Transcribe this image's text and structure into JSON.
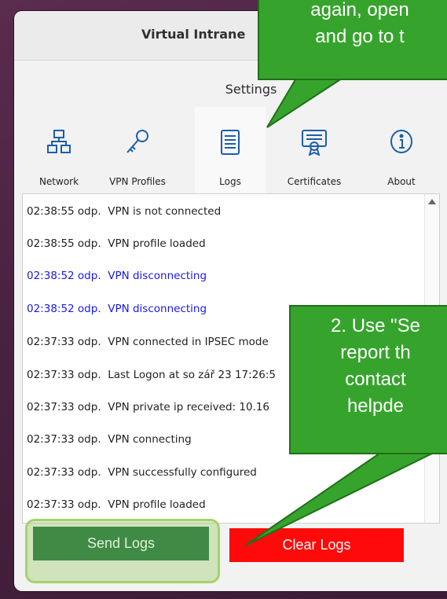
{
  "window": {
    "title": "Virtual Intrane"
  },
  "settings": {
    "label": "Settings"
  },
  "tabs": [
    {
      "label": "Network",
      "icon": "network-icon"
    },
    {
      "label": "VPN Profiles",
      "icon": "key-icon"
    },
    {
      "label": "Logs",
      "icon": "document-icon",
      "active": true
    },
    {
      "label": "Certificates",
      "icon": "certificate-icon"
    },
    {
      "label": "About",
      "icon": "info-icon"
    }
  ],
  "logs": [
    {
      "time": "02:38:55 odp.",
      "message": "VPN is not connected",
      "color": "#222222"
    },
    {
      "time": "02:38:55 odp.",
      "message": "VPN profile loaded",
      "color": "#222222"
    },
    {
      "time": "02:38:52 odp.",
      "message": "VPN disconnecting",
      "color": "#1a1ae6"
    },
    {
      "time": "02:38:52 odp.",
      "message": "VPN disconnecting",
      "color": "#1a1ae6"
    },
    {
      "time": "02:37:33 odp.",
      "message": "VPN connected in IPSEC mode",
      "color": "#222222"
    },
    {
      "time": "02:37:33 odp.",
      "message": "Last Logon at so zář 23 17:26:5",
      "color": "#222222"
    },
    {
      "time": "02:37:33 odp.",
      "message": "VPN private ip received: 10.16",
      "color": "#222222"
    },
    {
      "time": "02:37:33 odp.",
      "message": "VPN connecting",
      "color": "#222222"
    },
    {
      "time": "02:37:33 odp.",
      "message": "VPN successfully configured",
      "color": "#222222"
    },
    {
      "time": "02:37:33 odp.",
      "message": "VPN profile loaded",
      "color": "#222222"
    }
  ],
  "buttons": {
    "send_logs": "Send Logs",
    "clear_logs": "Clear Logs"
  },
  "callouts": {
    "top": [
      "again, open",
      "and go to t"
    ],
    "bottom": [
      "2. Use \"Se",
      "report th",
      "contact",
      "helpde"
    ]
  },
  "colors": {
    "send": "#3f8a45",
    "clear": "#ff0a0a",
    "callout": "#36a42c",
    "highlight": "#a3d36a"
  }
}
